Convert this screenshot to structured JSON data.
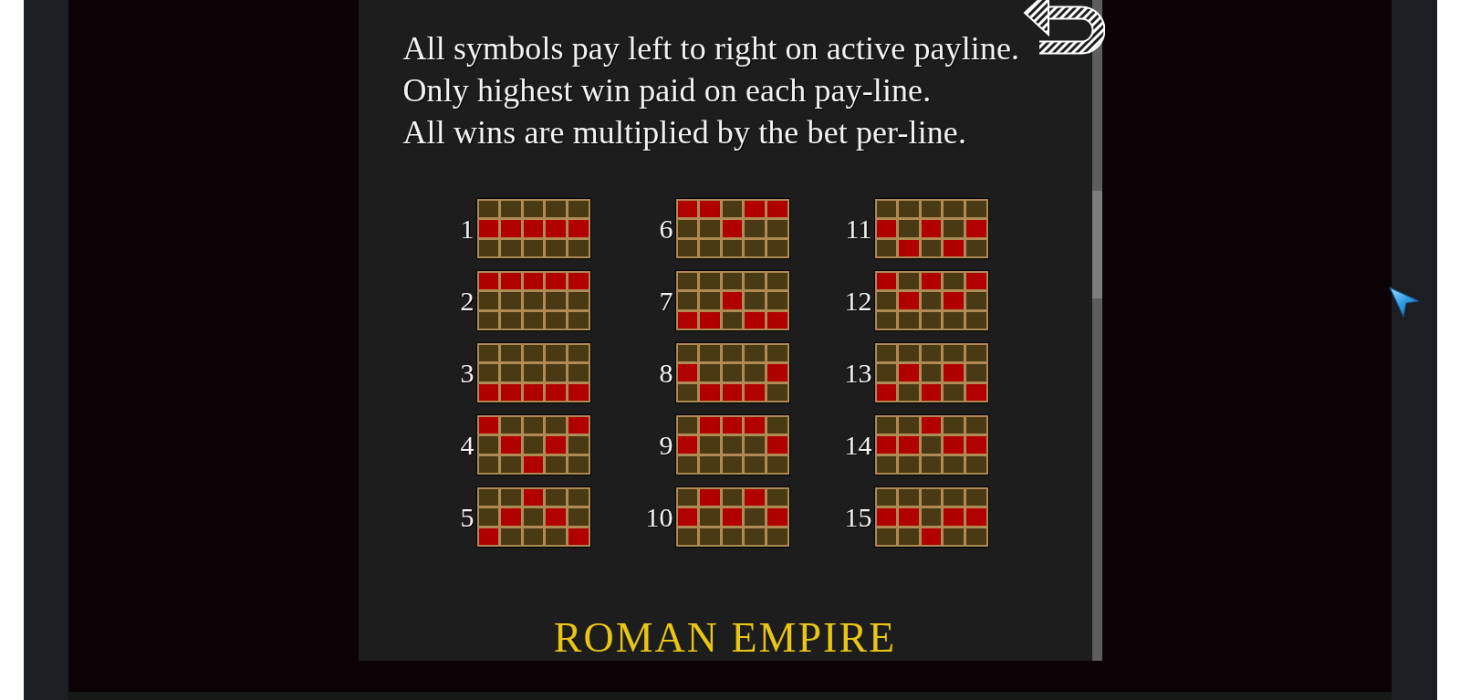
{
  "rules": [
    "All symbols pay left to right on active payline.",
    "Only highest win paid on each pay-line.",
    "All wins are multiplied by the bet per-line."
  ],
  "paylines": [
    {
      "number": "1",
      "cells": [
        [
          false,
          false,
          false,
          false,
          false
        ],
        [
          true,
          true,
          true,
          true,
          true
        ],
        [
          false,
          false,
          false,
          false,
          false
        ]
      ]
    },
    {
      "number": "2",
      "cells": [
        [
          true,
          true,
          true,
          true,
          true
        ],
        [
          false,
          false,
          false,
          false,
          false
        ],
        [
          false,
          false,
          false,
          false,
          false
        ]
      ]
    },
    {
      "number": "3",
      "cells": [
        [
          false,
          false,
          false,
          false,
          false
        ],
        [
          false,
          false,
          false,
          false,
          false
        ],
        [
          true,
          true,
          true,
          true,
          true
        ]
      ]
    },
    {
      "number": "4",
      "cells": [
        [
          true,
          false,
          false,
          false,
          true
        ],
        [
          false,
          true,
          false,
          true,
          false
        ],
        [
          false,
          false,
          true,
          false,
          false
        ]
      ]
    },
    {
      "number": "5",
      "cells": [
        [
          false,
          false,
          true,
          false,
          false
        ],
        [
          false,
          true,
          false,
          true,
          false
        ],
        [
          true,
          false,
          false,
          false,
          true
        ]
      ]
    },
    {
      "number": "6",
      "cells": [
        [
          true,
          true,
          false,
          true,
          true
        ],
        [
          false,
          false,
          true,
          false,
          false
        ],
        [
          false,
          false,
          false,
          false,
          false
        ]
      ]
    },
    {
      "number": "7",
      "cells": [
        [
          false,
          false,
          false,
          false,
          false
        ],
        [
          false,
          false,
          true,
          false,
          false
        ],
        [
          true,
          true,
          false,
          true,
          true
        ]
      ]
    },
    {
      "number": "8",
      "cells": [
        [
          false,
          false,
          false,
          false,
          false
        ],
        [
          true,
          false,
          false,
          false,
          true
        ],
        [
          false,
          true,
          true,
          true,
          false
        ]
      ]
    },
    {
      "number": "9",
      "cells": [
        [
          false,
          true,
          true,
          true,
          false
        ],
        [
          true,
          false,
          false,
          false,
          true
        ],
        [
          false,
          false,
          false,
          false,
          false
        ]
      ]
    },
    {
      "number": "10",
      "cells": [
        [
          false,
          true,
          false,
          true,
          false
        ],
        [
          true,
          false,
          true,
          false,
          true
        ],
        [
          false,
          false,
          false,
          false,
          false
        ]
      ]
    },
    {
      "number": "11",
      "cells": [
        [
          false,
          false,
          false,
          false,
          false
        ],
        [
          true,
          false,
          true,
          false,
          true
        ],
        [
          false,
          true,
          false,
          true,
          false
        ]
      ]
    },
    {
      "number": "12",
      "cells": [
        [
          true,
          false,
          true,
          false,
          true
        ],
        [
          false,
          true,
          false,
          true,
          false
        ],
        [
          false,
          false,
          false,
          false,
          false
        ]
      ]
    },
    {
      "number": "13",
      "cells": [
        [
          false,
          false,
          false,
          false,
          false
        ],
        [
          false,
          true,
          false,
          true,
          false
        ],
        [
          true,
          false,
          true,
          false,
          true
        ]
      ]
    },
    {
      "number": "14",
      "cells": [
        [
          false,
          false,
          true,
          false,
          false
        ],
        [
          true,
          true,
          false,
          true,
          true
        ],
        [
          false,
          false,
          false,
          false,
          false
        ]
      ]
    },
    {
      "number": "15",
      "cells": [
        [
          false,
          false,
          false,
          false,
          false
        ],
        [
          true,
          true,
          false,
          true,
          true
        ],
        [
          false,
          false,
          true,
          false,
          false
        ]
      ]
    }
  ],
  "title": "ROMAN EMPIRE"
}
